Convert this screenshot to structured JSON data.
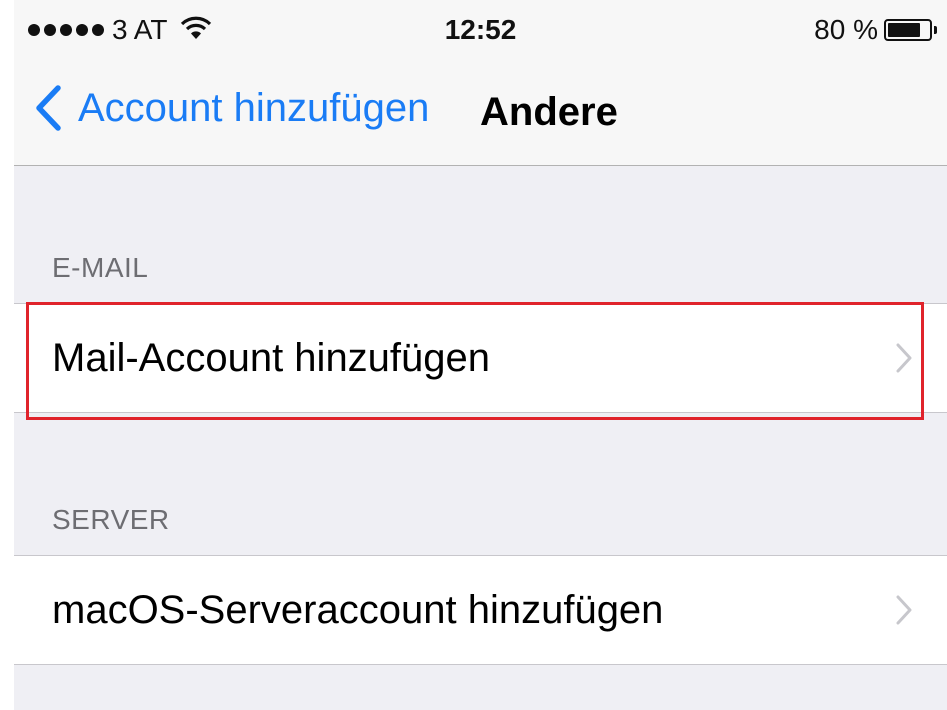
{
  "status_bar": {
    "carrier": "3 AT",
    "time": "12:52",
    "battery_percent": "80 %",
    "battery_level": 0.8
  },
  "nav_bar": {
    "back_label": "Account hinzufügen",
    "title": "Andere"
  },
  "sections": [
    {
      "header": "E-MAIL",
      "items": [
        {
          "label": "Mail-Account hinzufügen"
        }
      ]
    },
    {
      "header": "SERVER",
      "items": [
        {
          "label": "macOS-Serveraccount hinzufügen"
        }
      ]
    }
  ],
  "colors": {
    "accent": "#1a7cf5",
    "highlight": "#e0232b",
    "grouped_background": "#efeff4"
  }
}
